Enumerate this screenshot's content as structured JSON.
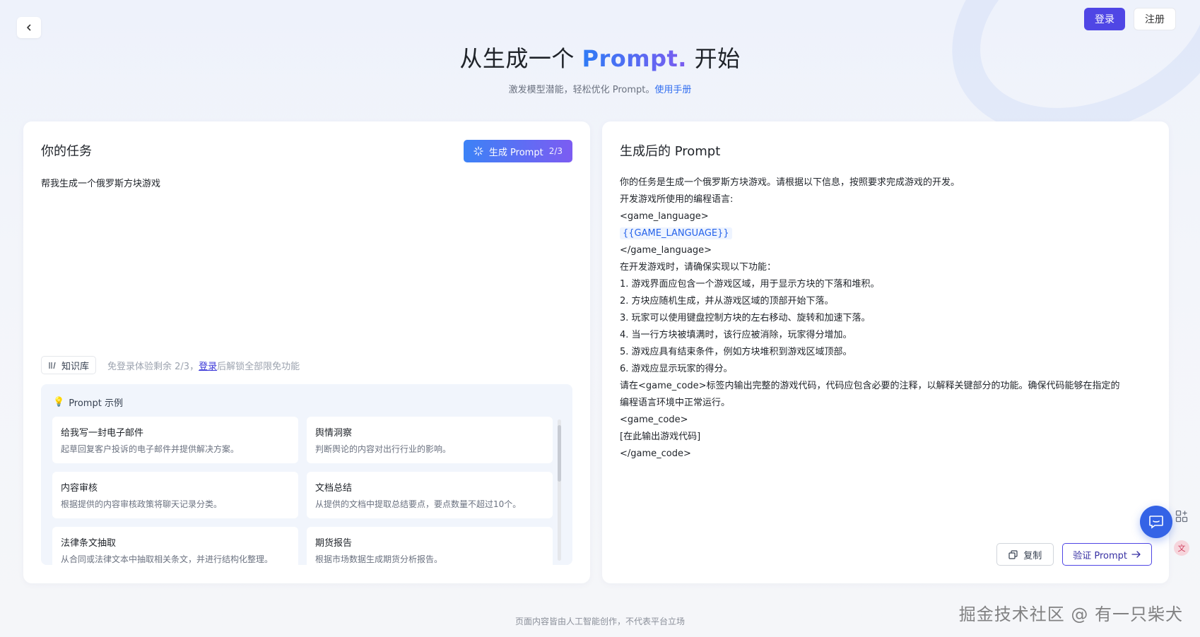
{
  "header": {
    "login_label": "登录",
    "register_label": "注册",
    "title_pre": "从生成一个",
    "title_accent": "Prompt.",
    "title_post": "开始",
    "subtitle_text": "激发模型潜能，轻松优化 Prompt。",
    "subtitle_link": "使用手册"
  },
  "left": {
    "title": "你的任务",
    "generate_label": "生成 Prompt",
    "generate_count": "2/3",
    "task_value": "帮我生成一个俄罗斯方块游戏",
    "kb_label": "知识库",
    "trial_prefix": "免登录体验剩余 2/3，",
    "trial_login": "登录",
    "trial_suffix": "后解锁全部限免功能",
    "examples_title": "Prompt 示例",
    "examples": [
      {
        "title": "给我写一封电子邮件",
        "desc": "起草回复客户投诉的电子邮件并提供解决方案。"
      },
      {
        "title": "舆情洞察",
        "desc": "判断舆论的内容对出行行业的影响。"
      },
      {
        "title": "内容审核",
        "desc": "根据提供的内容审核政策将聊天记录分类。"
      },
      {
        "title": "文档总结",
        "desc": "从提供的文档中提取总结要点，要点数量不超过10个。"
      },
      {
        "title": "法律条文抽取",
        "desc": "从合同或法律文本中抽取相关条文，并进行结构化整理。"
      },
      {
        "title": "期货报告",
        "desc": "根据市场数据生成期货分析报告。"
      }
    ]
  },
  "right": {
    "title": "生成后的 Prompt",
    "lines": [
      "你的任务是生成一个俄罗斯方块游戏。请根据以下信息，按照要求完成游戏的开发。",
      "开发游戏所使用的编程语言:",
      "<game_language>",
      "{{GAME_LANGUAGE}}",
      "</game_language>",
      "在开发游戏时，请确保实现以下功能：",
      "1. 游戏界面应包含一个游戏区域，用于显示方块的下落和堆积。",
      "2. 方块应随机生成，并从游戏区域的顶部开始下落。",
      "3. 玩家可以使用键盘控制方块的左右移动、旋转和加速下落。",
      "4. 当一行方块被填满时，该行应被消除，玩家得分增加。",
      "5. 游戏应具有结束条件，例如方块堆积到游戏区域顶部。",
      "6. 游戏应显示玩家的得分。",
      "请在<game_code>标签内输出完整的游戏代码，代码应包含必要的注释，以解释关键部分的功能。确保代码能够在指定的",
      "编程语言环境中正常运行。",
      "<game_code>",
      "[在此输出游戏代码]",
      "</game_code>"
    ],
    "copy_label": "复制",
    "verify_label": "验证 Prompt"
  },
  "footer": {
    "note": "页面内容皆由人工智能创作，不代表平台立场",
    "watermark": "掘金技术社区 @ 有一只柴犬"
  },
  "colors": {
    "primary": "#4f46e5",
    "gradient_start": "#3c82f6",
    "gradient_end": "#7c5cf2",
    "link": "#2f6cf0"
  }
}
